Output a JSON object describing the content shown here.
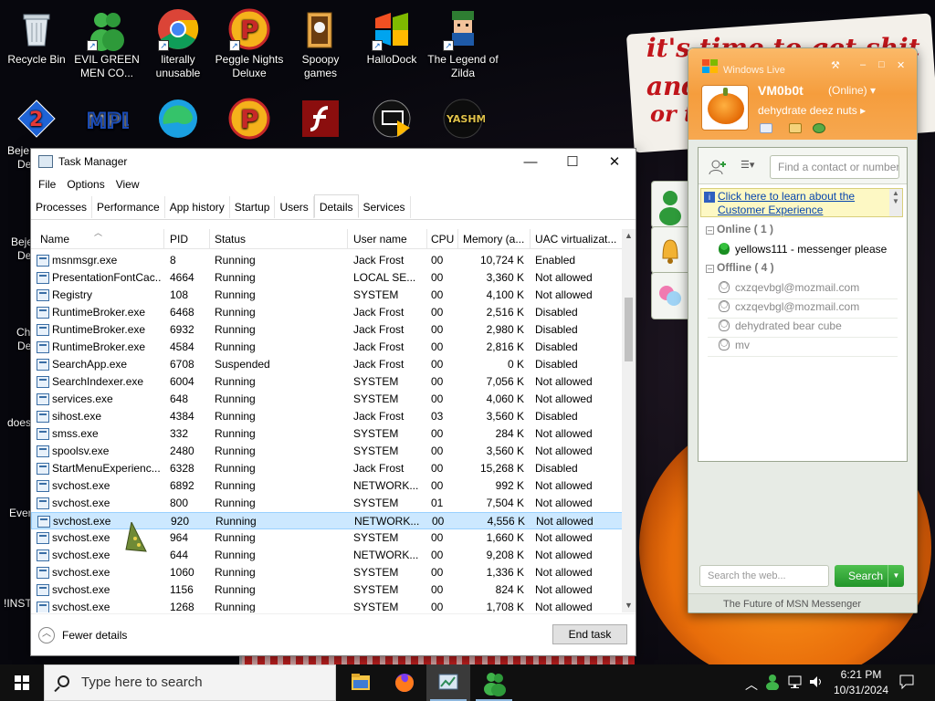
{
  "wallpaper": {
    "lines": [
      "it's time to get shit",
      "and",
      "or t"
    ]
  },
  "desktop": {
    "row1": [
      {
        "name": "recycle-bin",
        "label": "Recycle Bin"
      },
      {
        "name": "evil-green-men",
        "label": "EVIL GREEN MEN CO..."
      },
      {
        "name": "chrome",
        "label": "literally unusable"
      },
      {
        "name": "peggle",
        "label": "Peggle Nights Deluxe"
      },
      {
        "name": "spoopy",
        "label": "Spoopy games"
      },
      {
        "name": "hallodock",
        "label": "HalloDock"
      },
      {
        "name": "zilda",
        "label": "The Legend of Zilda"
      }
    ],
    "left_edge": [
      "Beje",
      "De",
      "Beje",
      "De",
      "Ch",
      "De",
      "does",
      "Ever",
      "!INST"
    ]
  },
  "task_manager": {
    "title": "Task Manager",
    "menu": [
      "File",
      "Options",
      "View"
    ],
    "tabs": [
      "Processes",
      "Performance",
      "App history",
      "Startup",
      "Users",
      "Details",
      "Services"
    ],
    "active_tab": "Details",
    "columns": [
      "Name",
      "PID",
      "Status",
      "User name",
      "CPU",
      "Memory (a...",
      "UAC virtualizat..."
    ],
    "rows": [
      {
        "name": "msnmsgr.exe",
        "pid": "8",
        "status": "Running",
        "user": "Jack Frost",
        "cpu": "00",
        "mem": "10,724 K",
        "uac": "Enabled"
      },
      {
        "name": "PresentationFontCac...",
        "pid": "4664",
        "status": "Running",
        "user": "LOCAL SE...",
        "cpu": "00",
        "mem": "3,360 K",
        "uac": "Not allowed"
      },
      {
        "name": "Registry",
        "pid": "108",
        "status": "Running",
        "user": "SYSTEM",
        "cpu": "00",
        "mem": "4,100 K",
        "uac": "Not allowed"
      },
      {
        "name": "RuntimeBroker.exe",
        "pid": "6468",
        "status": "Running",
        "user": "Jack Frost",
        "cpu": "00",
        "mem": "2,516 K",
        "uac": "Disabled"
      },
      {
        "name": "RuntimeBroker.exe",
        "pid": "6932",
        "status": "Running",
        "user": "Jack Frost",
        "cpu": "00",
        "mem": "2,980 K",
        "uac": "Disabled"
      },
      {
        "name": "RuntimeBroker.exe",
        "pid": "4584",
        "status": "Running",
        "user": "Jack Frost",
        "cpu": "00",
        "mem": "2,816 K",
        "uac": "Disabled"
      },
      {
        "name": "SearchApp.exe",
        "pid": "6708",
        "status": "Suspended",
        "user": "Jack Frost",
        "cpu": "00",
        "mem": "0 K",
        "uac": "Disabled"
      },
      {
        "name": "SearchIndexer.exe",
        "pid": "6004",
        "status": "Running",
        "user": "SYSTEM",
        "cpu": "00",
        "mem": "7,056 K",
        "uac": "Not allowed"
      },
      {
        "name": "services.exe",
        "pid": "648",
        "status": "Running",
        "user": "SYSTEM",
        "cpu": "00",
        "mem": "4,060 K",
        "uac": "Not allowed"
      },
      {
        "name": "sihost.exe",
        "pid": "4384",
        "status": "Running",
        "user": "Jack Frost",
        "cpu": "03",
        "mem": "3,560 K",
        "uac": "Disabled"
      },
      {
        "name": "smss.exe",
        "pid": "332",
        "status": "Running",
        "user": "SYSTEM",
        "cpu": "00",
        "mem": "284 K",
        "uac": "Not allowed"
      },
      {
        "name": "spoolsv.exe",
        "pid": "2480",
        "status": "Running",
        "user": "SYSTEM",
        "cpu": "00",
        "mem": "3,560 K",
        "uac": "Not allowed"
      },
      {
        "name": "StartMenuExperienc...",
        "pid": "6328",
        "status": "Running",
        "user": "Jack Frost",
        "cpu": "00",
        "mem": "15,268 K",
        "uac": "Disabled"
      },
      {
        "name": "svchost.exe",
        "pid": "6892",
        "status": "Running",
        "user": "NETWORK...",
        "cpu": "00",
        "mem": "992 K",
        "uac": "Not allowed"
      },
      {
        "name": "svchost.exe",
        "pid": "800",
        "status": "Running",
        "user": "SYSTEM",
        "cpu": "01",
        "mem": "7,504 K",
        "uac": "Not allowed"
      },
      {
        "name": "svchost.exe",
        "pid": "920",
        "status": "Running",
        "user": "NETWORK...",
        "cpu": "00",
        "mem": "4,556 K",
        "uac": "Not allowed"
      },
      {
        "name": "svchost.exe",
        "pid": "964",
        "status": "Running",
        "user": "SYSTEM",
        "cpu": "00",
        "mem": "1,660 K",
        "uac": "Not allowed"
      },
      {
        "name": "svchost.exe",
        "pid": "644",
        "status": "Running",
        "user": "NETWORK...",
        "cpu": "00",
        "mem": "9,208 K",
        "uac": "Not allowed"
      },
      {
        "name": "svchost.exe",
        "pid": "1060",
        "status": "Running",
        "user": "SYSTEM",
        "cpu": "00",
        "mem": "1,336 K",
        "uac": "Not allowed"
      },
      {
        "name": "svchost.exe",
        "pid": "1156",
        "status": "Running",
        "user": "SYSTEM",
        "cpu": "00",
        "mem": "824 K",
        "uac": "Not allowed"
      },
      {
        "name": "svchost.exe",
        "pid": "1268",
        "status": "Running",
        "user": "SYSTEM",
        "cpu": "00",
        "mem": "1,708 K",
        "uac": "Not allowed"
      }
    ],
    "selected_pid": "920",
    "fewer_details": "Fewer details",
    "end_task": "End task"
  },
  "messenger": {
    "title": "Windows Live",
    "display_name": "VM0b0t",
    "status": "(Online)",
    "personal_message": "dehydrate deez nuts",
    "find_placeholder": "Find a contact or number",
    "promo_link": "Click here to learn about the Customer Experience",
    "groups": [
      {
        "label": "Online ( 1 )",
        "contacts": [
          "yellows111 - messenger please"
        ]
      },
      {
        "label": "Offline ( 4 )",
        "contacts": [
          "cxzqevbgl@mozmail.com",
          "cxzqevbgl@mozmail.com",
          "dehydrated bear cube",
          "mv"
        ]
      }
    ],
    "search_placeholder": "Search the web...",
    "search_button": "Search",
    "footer": "The Future of MSN Messenger"
  },
  "taskbar": {
    "search_placeholder": "Type here to search",
    "time": "6:21 PM",
    "date": "10/31/2024"
  },
  "colors": {
    "selection": "#cce8ff",
    "msn_orange": "#f59d3d",
    "msn_green": "#22952a"
  }
}
